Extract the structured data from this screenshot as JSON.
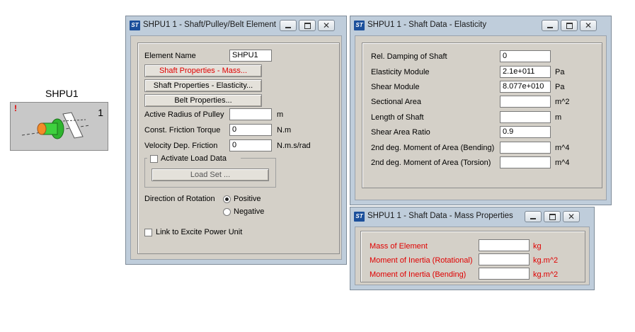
{
  "element": {
    "label": "SHPU1",
    "badge": "1",
    "warning": "!"
  },
  "win1": {
    "title": "SHPU1 1 - Shaft/Pulley/Belt Element",
    "element_name_label": "Element Name",
    "element_name_value": "SHPU1",
    "btn_mass": "Shaft Properties - Mass...",
    "btn_elasticity": "Shaft Properties - Elasticity...",
    "btn_belt": "Belt Properties...",
    "rows": [
      {
        "label": "Active Radius of Pulley",
        "value": "",
        "unit": "m"
      },
      {
        "label": "Const. Friction Torque",
        "value": "0",
        "unit": "N.m"
      },
      {
        "label": "Velocity Dep. Friction",
        "value": "0",
        "unit": "N.m.s/rad"
      }
    ],
    "activate_load_label": "Activate Load Data",
    "load_set_label": "Load Set ...",
    "direction_label": "Direction of Rotation",
    "positive_label": "Positive",
    "negative_label": "Negative",
    "link_label": "Link to Excite Power Unit"
  },
  "win2": {
    "title": "SHPU1 1 - Shaft Data - Elasticity",
    "rows": [
      {
        "label": "Rel. Damping of Shaft",
        "value": "0",
        "unit": ""
      },
      {
        "label": "Elasticity Module",
        "value": "2.1e+011",
        "unit": "Pa"
      },
      {
        "label": "Shear Module",
        "value": "8.077e+010",
        "unit": "Pa"
      },
      {
        "label": "Sectional Area",
        "value": "",
        "unit": "m^2"
      },
      {
        "label": "Length of Shaft",
        "value": "",
        "unit": "m"
      },
      {
        "label": "Shear Area Ratio",
        "value": "0.9",
        "unit": ""
      },
      {
        "label": "2nd deg. Moment of Area (Bending)",
        "value": "",
        "unit": "m^4"
      },
      {
        "label": "2nd deg. Moment of Area (Torsion)",
        "value": "",
        "unit": "m^4"
      }
    ]
  },
  "win3": {
    "title": "SHPU1 1 - Shaft Data - Mass Properties",
    "rows": [
      {
        "label": "Mass of Element",
        "value": "",
        "unit": "kg"
      },
      {
        "label": "Moment of Inertia (Rotational)",
        "value": "",
        "unit": "kg.m^2"
      },
      {
        "label": "Moment of Inertia (Bending)",
        "value": "",
        "unit": "kg.m^2"
      }
    ]
  },
  "colors": {
    "window_frame": "#bfcddb",
    "dialog_bg": "#d4d0c8",
    "required_red": "#e00000",
    "pulley_green": "#3fd13f",
    "pulley_orange": "#f28c28"
  }
}
